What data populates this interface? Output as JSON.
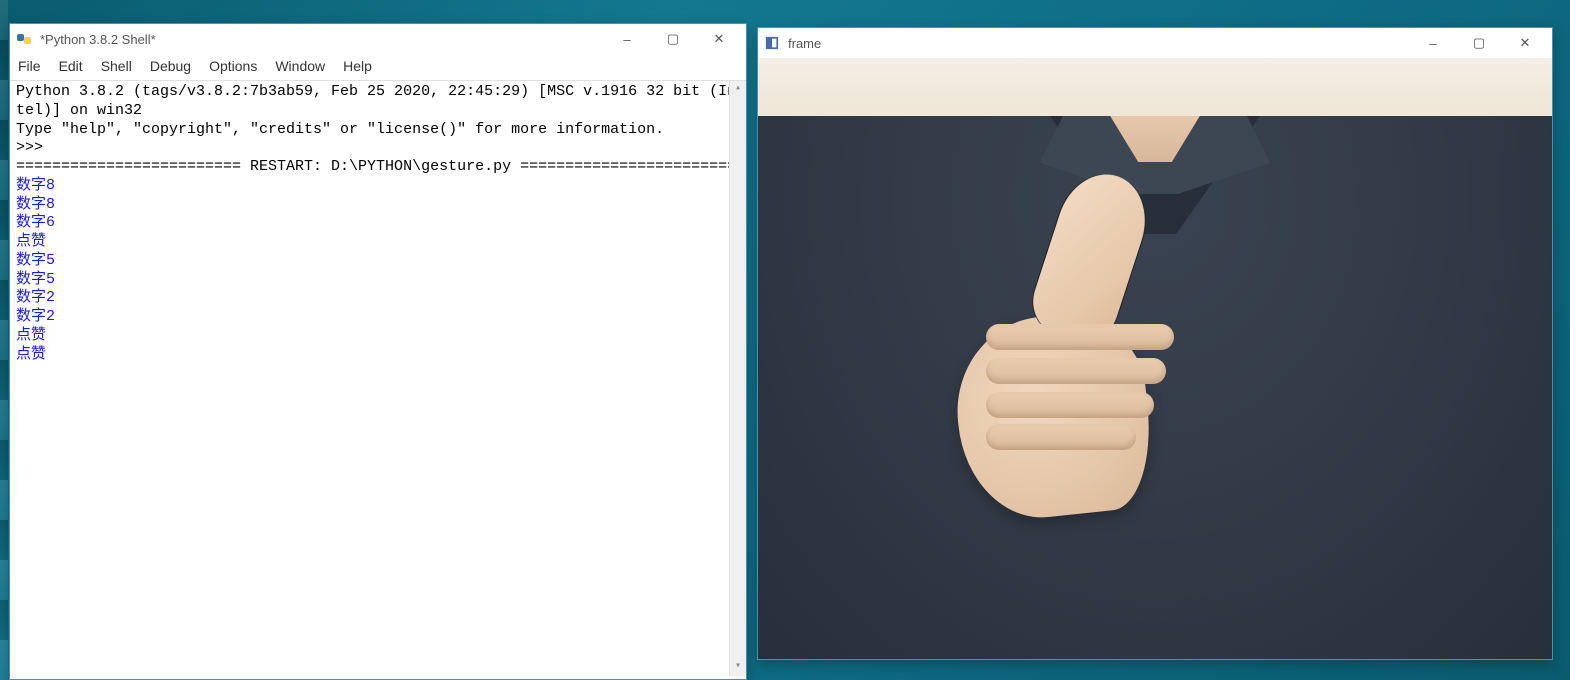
{
  "idle_window": {
    "title": "*Python 3.8.2 Shell*",
    "menu": [
      "File",
      "Edit",
      "Shell",
      "Debug",
      "Options",
      "Window",
      "Help"
    ],
    "banner_line1": "Python 3.8.2 (tags/v3.8.2:7b3ab59, Feb 25 2020, 22:45:29) [MSC v.1916 32 bit (In",
    "banner_line2": "tel)] on win32",
    "banner_line3": "Type \"help\", \"copyright\", \"credits\" or \"license()\" for more information.",
    "prompt": ">>> ",
    "restart_line": "========================= RESTART: D:\\PYTHON\\gesture.py ========================",
    "output_lines": [
      "数字8",
      "数字8",
      "数字6",
      "点赞",
      "数字5",
      "数字5",
      "数字2",
      "数字2",
      "点赞",
      "点赞"
    ]
  },
  "frame_window": {
    "title": "frame",
    "description": "webcam feed showing a person in a dark v-neck sweater holding up a hand in a thumbs-up / finger-heart gesture"
  },
  "win_controls": {
    "minimize": "–",
    "maximize": "▢",
    "close": "✕"
  }
}
